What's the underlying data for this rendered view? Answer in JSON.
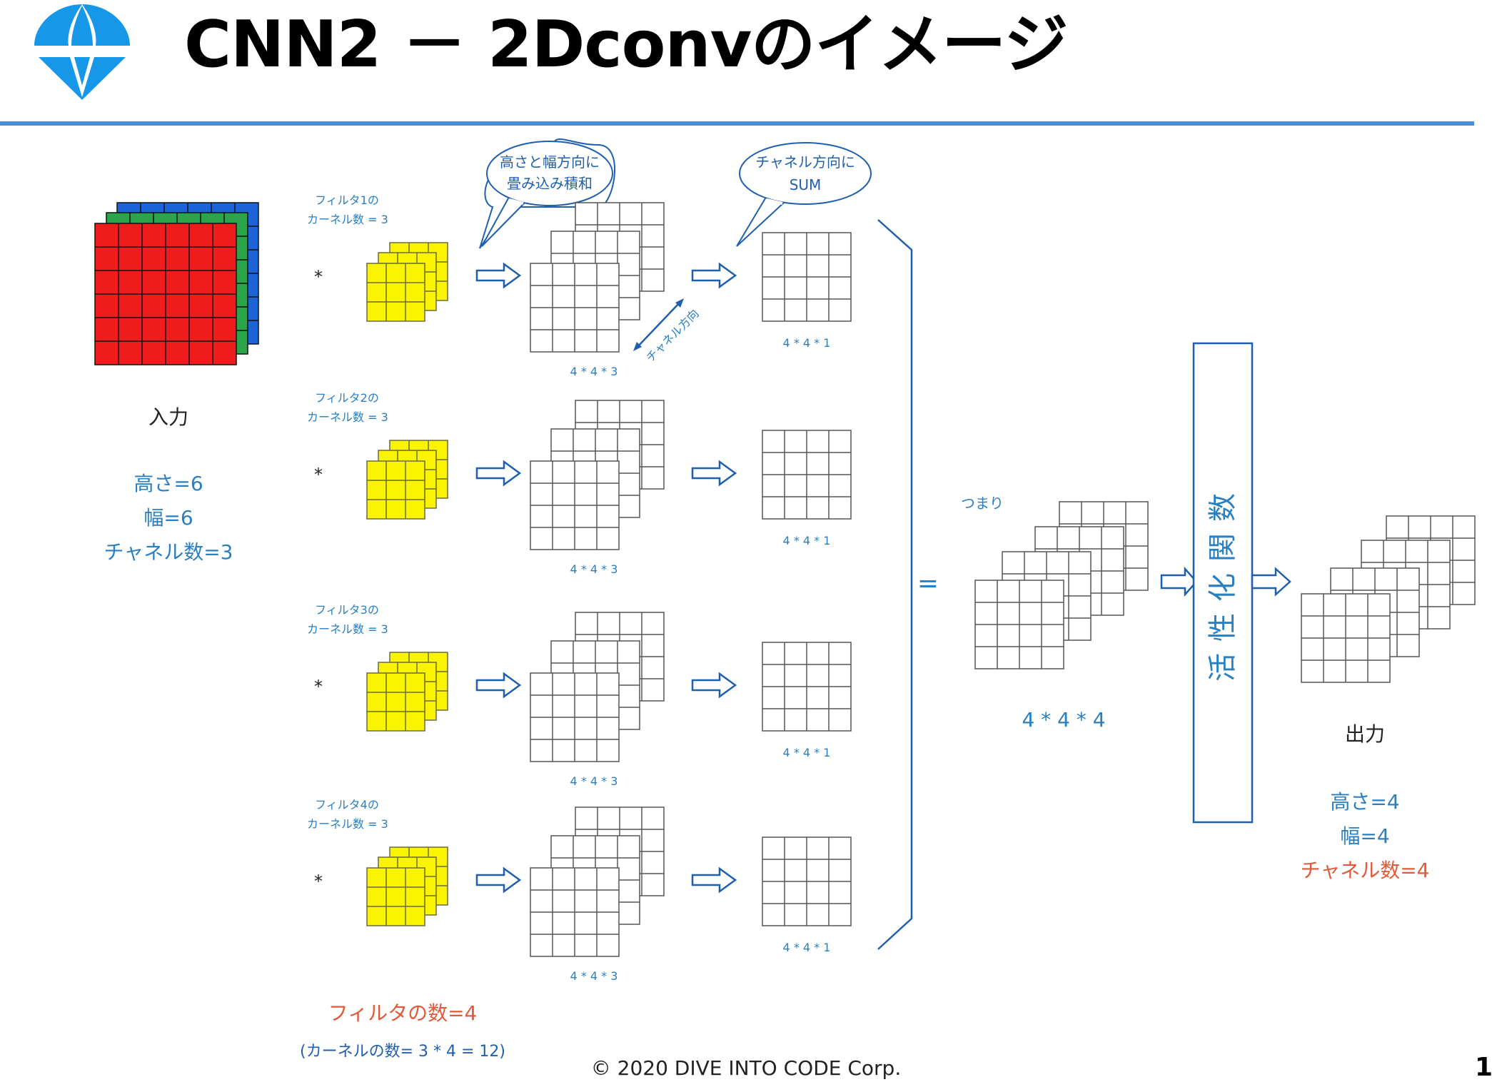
{
  "header": {
    "title": "CNN2 － 2Dconvのイメージ"
  },
  "input": {
    "label": "入力",
    "height_text": "高さ=6",
    "width_text": "幅=6",
    "channels_text": "チャネル数=3"
  },
  "filters": [
    {
      "name": "フィルタ1の",
      "kernels": "カーネル数 = 3",
      "op": "*",
      "conv_dim": "4 * 4 * 3",
      "sum_dim": "4 * 4 * 1"
    },
    {
      "name": "フィルタ2の",
      "kernels": "カーネル数 = 3",
      "op": "*",
      "conv_dim": "4 * 4 * 3",
      "sum_dim": "4 * 4 * 1"
    },
    {
      "name": "フィルタ3の",
      "kernels": "カーネル数 = 3",
      "op": "*",
      "conv_dim": "4 * 4 * 3",
      "sum_dim": "4 * 4 * 1"
    },
    {
      "name": "フィルタ4の",
      "kernels": "カーネル数 = 3",
      "op": "*",
      "conv_dim": "4 * 4 * 3",
      "sum_dim": "4 * 4 * 1"
    }
  ],
  "bubbles": {
    "conv_line1": "高さと幅方向に",
    "conv_line2": "畳み込み積和",
    "sum_line1": "チャネル方向に",
    "sum_line2": "SUM"
  },
  "channel_direction": "チャネル方向",
  "filter_count": "フィルタの数=4",
  "kernel_count_note": "(カーネルの数= 3 * 4 = 12)",
  "equals": "=",
  "summary": {
    "label": "つまり",
    "dim": "4 * 4 * 4"
  },
  "activation": "活性化関数",
  "output": {
    "label": "出力",
    "height_text": "高さ=4",
    "width_text": "幅=4",
    "channels_text": "チャネル数=4"
  },
  "footer": {
    "copyright": "© 2020 DIVE INTO CODE Corp.",
    "page": "1"
  },
  "colors": {
    "accent_blue": "#1f5fae",
    "text_blue": "#2a7fc0",
    "text_red": "#e05a3a",
    "input_red": "#ee1c1c",
    "input_green": "#2ca44a",
    "input_blue": "#1c64d8",
    "filter_yellow": "#fbf400",
    "rule_blue": "#4a90d9",
    "logo_blue": "#1697e8"
  }
}
